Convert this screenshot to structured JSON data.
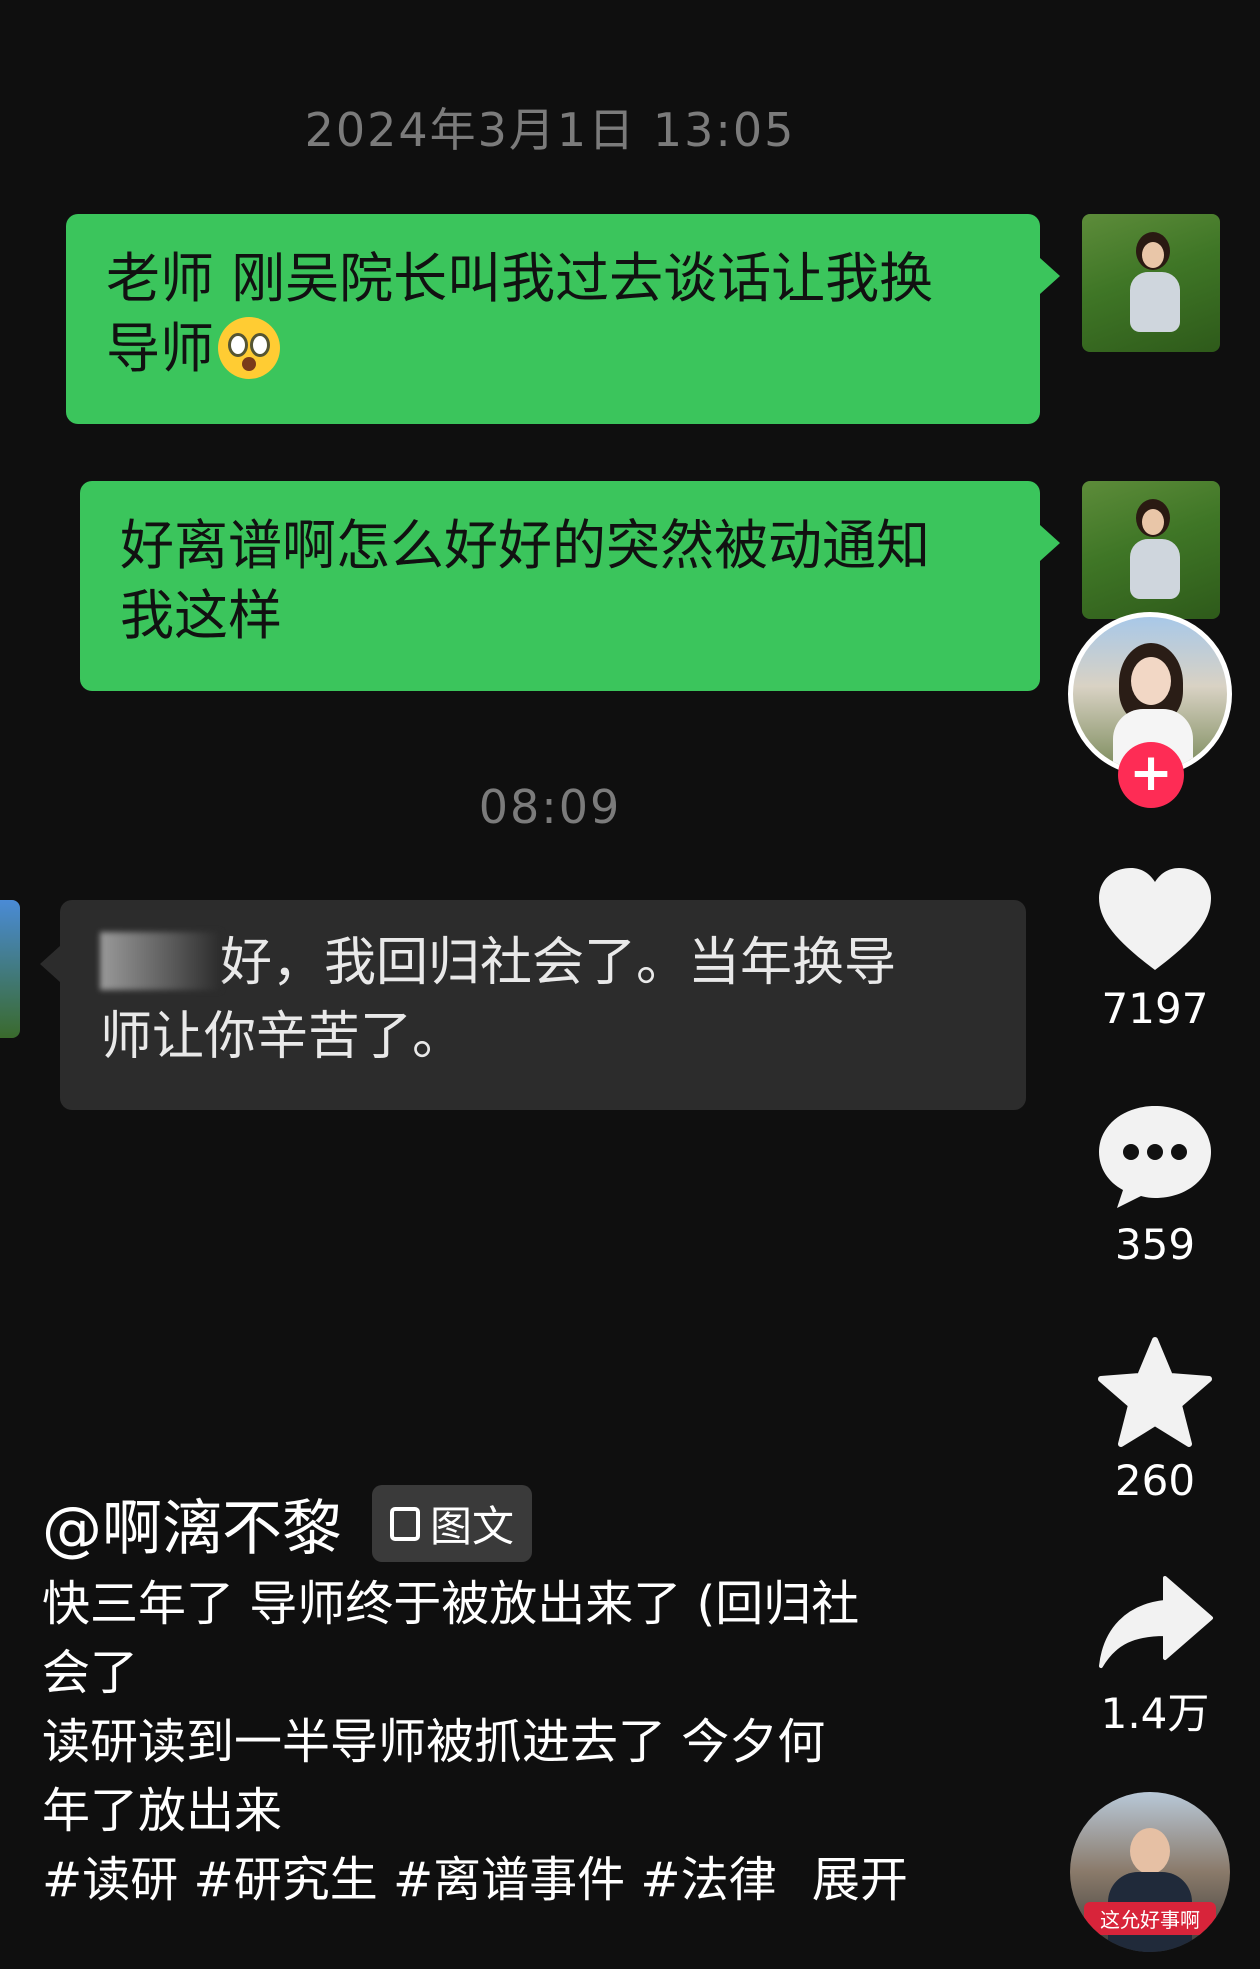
{
  "chat": {
    "timestamp_1": "2024年3月1日 13:05",
    "msg_1_line1": "老师 刚吴院长叫我过去谈话让我换",
    "msg_1_line2": "导师",
    "msg_2_line1": "好离谱啊怎么好好的突然被动通知",
    "msg_2_line2": "我这样",
    "timestamp_2": "08:09",
    "reply_line1_rest": "好，我回归社会了。当年换导",
    "reply_line2": "师让你辛苦了。"
  },
  "rail": {
    "follow_label": "+",
    "likes": "7197",
    "comments": "359",
    "favorites": "260",
    "shares": "1.4万"
  },
  "post": {
    "author": "@啊漓不黎",
    "type_chip": "图文",
    "caption_line1": "快三年了 导师终于被放出来了 (回归社",
    "caption_line2": "会了",
    "caption_line3": "读研读到一半导师被抓进去了 今夕何",
    "caption_line4": "年了放出来",
    "hashtags": "#读研 #研究生 #离谱事件 #法律",
    "expand": "展开"
  },
  "music": {
    "disc_label": "这允好事啊"
  },
  "icons": {
    "like": "heart-icon",
    "comment": "comment-bubble-icon",
    "favorite": "star-icon",
    "share": "share-arrow-icon",
    "chip": "gallery-icon",
    "emoji": "surprised-face-emoji"
  }
}
